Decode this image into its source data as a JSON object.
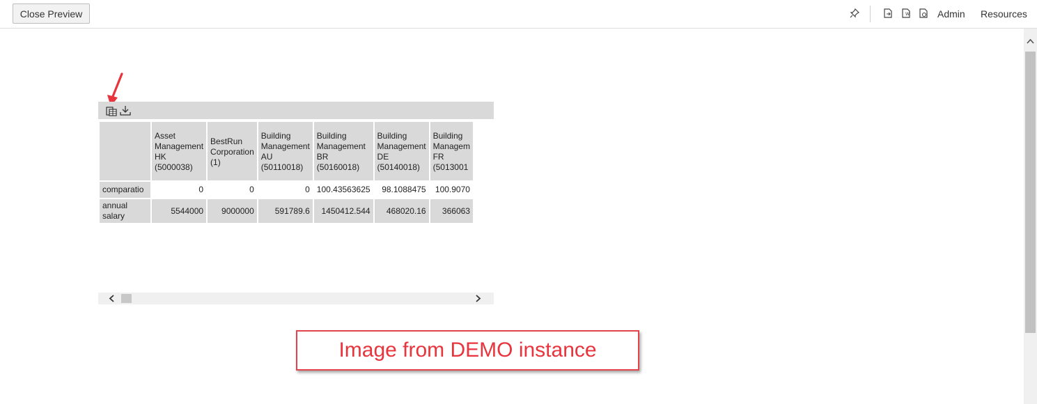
{
  "toolbar": {
    "close_preview_label": "Close Preview",
    "admin_label": "Admin",
    "resources_label": "Resources",
    "icons": [
      "pin-icon",
      "export-pdf-icon",
      "export-word-icon",
      "export-ppt-icon"
    ]
  },
  "report": {
    "toolbar_icons": [
      "table-view-icon",
      "download-icon"
    ],
    "columns": [
      [
        "Asset",
        "Management",
        "HK",
        "(5000038)"
      ],
      [
        "BestRun",
        "Corporation",
        "(1)"
      ],
      [
        "Building",
        "Management",
        "AU",
        "(50110018)"
      ],
      [
        "Building",
        "Management",
        "BR",
        "(50160018)"
      ],
      [
        "Building",
        "Management",
        "DE",
        "(50140018)"
      ],
      [
        "Building",
        "Managem",
        "FR",
        "(5013001"
      ]
    ],
    "rows": [
      {
        "label": [
          "comparatio"
        ],
        "values": [
          "0",
          "0",
          "0",
          "100.43563625",
          "98.1088475",
          "100.9070"
        ]
      },
      {
        "label": [
          "annual",
          "salary"
        ],
        "values": [
          "5544000",
          "9000000",
          "591789.6",
          "1450412.544",
          "468020.16",
          "366063"
        ]
      }
    ]
  },
  "annotation": {
    "text": "Image from DEMO instance",
    "color": "#e8343c"
  },
  "colors": {
    "table_header_bg": "#d9d9d9",
    "arrow": "#e8343c"
  }
}
